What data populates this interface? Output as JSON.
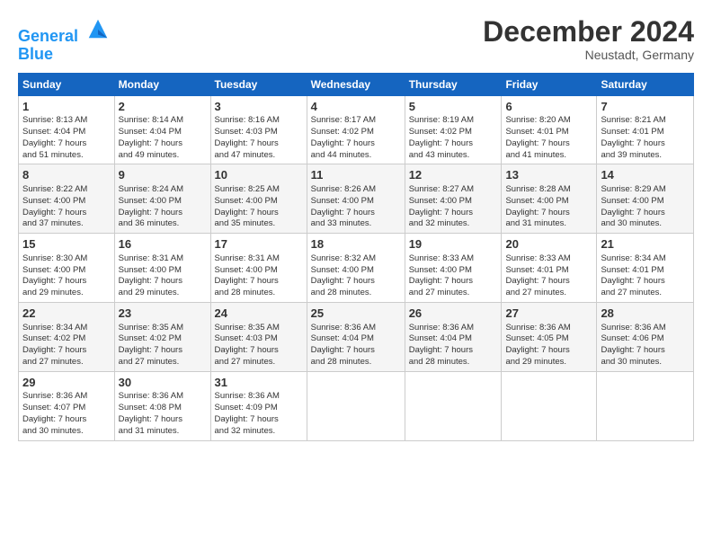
{
  "header": {
    "logo_line1": "General",
    "logo_line2": "Blue",
    "month": "December 2024",
    "location": "Neustadt, Germany"
  },
  "days_of_week": [
    "Sunday",
    "Monday",
    "Tuesday",
    "Wednesday",
    "Thursday",
    "Friday",
    "Saturday"
  ],
  "weeks": [
    [
      {
        "day": "1",
        "info": "Sunrise: 8:13 AM\nSunset: 4:04 PM\nDaylight: 7 hours\nand 51 minutes."
      },
      {
        "day": "2",
        "info": "Sunrise: 8:14 AM\nSunset: 4:04 PM\nDaylight: 7 hours\nand 49 minutes."
      },
      {
        "day": "3",
        "info": "Sunrise: 8:16 AM\nSunset: 4:03 PM\nDaylight: 7 hours\nand 47 minutes."
      },
      {
        "day": "4",
        "info": "Sunrise: 8:17 AM\nSunset: 4:02 PM\nDaylight: 7 hours\nand 44 minutes."
      },
      {
        "day": "5",
        "info": "Sunrise: 8:19 AM\nSunset: 4:02 PM\nDaylight: 7 hours\nand 43 minutes."
      },
      {
        "day": "6",
        "info": "Sunrise: 8:20 AM\nSunset: 4:01 PM\nDaylight: 7 hours\nand 41 minutes."
      },
      {
        "day": "7",
        "info": "Sunrise: 8:21 AM\nSunset: 4:01 PM\nDaylight: 7 hours\nand 39 minutes."
      }
    ],
    [
      {
        "day": "8",
        "info": "Sunrise: 8:22 AM\nSunset: 4:00 PM\nDaylight: 7 hours\nand 37 minutes."
      },
      {
        "day": "9",
        "info": "Sunrise: 8:24 AM\nSunset: 4:00 PM\nDaylight: 7 hours\nand 36 minutes."
      },
      {
        "day": "10",
        "info": "Sunrise: 8:25 AM\nSunset: 4:00 PM\nDaylight: 7 hours\nand 35 minutes."
      },
      {
        "day": "11",
        "info": "Sunrise: 8:26 AM\nSunset: 4:00 PM\nDaylight: 7 hours\nand 33 minutes."
      },
      {
        "day": "12",
        "info": "Sunrise: 8:27 AM\nSunset: 4:00 PM\nDaylight: 7 hours\nand 32 minutes."
      },
      {
        "day": "13",
        "info": "Sunrise: 8:28 AM\nSunset: 4:00 PM\nDaylight: 7 hours\nand 31 minutes."
      },
      {
        "day": "14",
        "info": "Sunrise: 8:29 AM\nSunset: 4:00 PM\nDaylight: 7 hours\nand 30 minutes."
      }
    ],
    [
      {
        "day": "15",
        "info": "Sunrise: 8:30 AM\nSunset: 4:00 PM\nDaylight: 7 hours\nand 29 minutes."
      },
      {
        "day": "16",
        "info": "Sunrise: 8:31 AM\nSunset: 4:00 PM\nDaylight: 7 hours\nand 29 minutes."
      },
      {
        "day": "17",
        "info": "Sunrise: 8:31 AM\nSunset: 4:00 PM\nDaylight: 7 hours\nand 28 minutes."
      },
      {
        "day": "18",
        "info": "Sunrise: 8:32 AM\nSunset: 4:00 PM\nDaylight: 7 hours\nand 28 minutes."
      },
      {
        "day": "19",
        "info": "Sunrise: 8:33 AM\nSunset: 4:00 PM\nDaylight: 7 hours\nand 27 minutes."
      },
      {
        "day": "20",
        "info": "Sunrise: 8:33 AM\nSunset: 4:01 PM\nDaylight: 7 hours\nand 27 minutes."
      },
      {
        "day": "21",
        "info": "Sunrise: 8:34 AM\nSunset: 4:01 PM\nDaylight: 7 hours\nand 27 minutes."
      }
    ],
    [
      {
        "day": "22",
        "info": "Sunrise: 8:34 AM\nSunset: 4:02 PM\nDaylight: 7 hours\nand 27 minutes."
      },
      {
        "day": "23",
        "info": "Sunrise: 8:35 AM\nSunset: 4:02 PM\nDaylight: 7 hours\nand 27 minutes."
      },
      {
        "day": "24",
        "info": "Sunrise: 8:35 AM\nSunset: 4:03 PM\nDaylight: 7 hours\nand 27 minutes."
      },
      {
        "day": "25",
        "info": "Sunrise: 8:36 AM\nSunset: 4:04 PM\nDaylight: 7 hours\nand 28 minutes."
      },
      {
        "day": "26",
        "info": "Sunrise: 8:36 AM\nSunset: 4:04 PM\nDaylight: 7 hours\nand 28 minutes."
      },
      {
        "day": "27",
        "info": "Sunrise: 8:36 AM\nSunset: 4:05 PM\nDaylight: 7 hours\nand 29 minutes."
      },
      {
        "day": "28",
        "info": "Sunrise: 8:36 AM\nSunset: 4:06 PM\nDaylight: 7 hours\nand 30 minutes."
      }
    ],
    [
      {
        "day": "29",
        "info": "Sunrise: 8:36 AM\nSunset: 4:07 PM\nDaylight: 7 hours\nand 30 minutes."
      },
      {
        "day": "30",
        "info": "Sunrise: 8:36 AM\nSunset: 4:08 PM\nDaylight: 7 hours\nand 31 minutes."
      },
      {
        "day": "31",
        "info": "Sunrise: 8:36 AM\nSunset: 4:09 PM\nDaylight: 7 hours\nand 32 minutes."
      },
      null,
      null,
      null,
      null
    ]
  ]
}
